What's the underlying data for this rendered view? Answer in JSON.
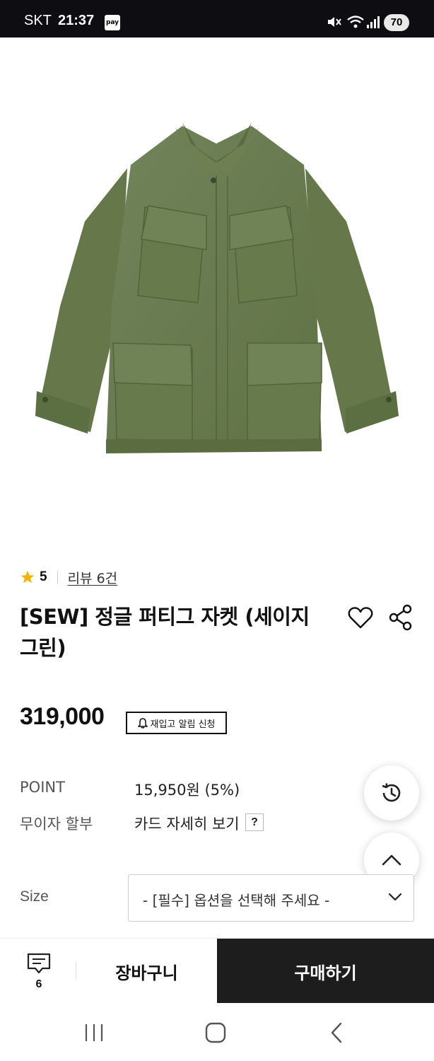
{
  "status_bar": {
    "carrier": "SKT",
    "time": "21:37",
    "pay_badge": "pay",
    "battery": "70",
    "icons": [
      "mute-icon",
      "wifi-icon",
      "signal-icon"
    ]
  },
  "product": {
    "image_alt": "product-image",
    "rating": {
      "score": "5",
      "review_link": "리뷰 6건",
      "star_color": "#f5b301"
    },
    "title": "[SEW] 정글 퍼티그 자켓 (세이지 그린)",
    "price": "319,000",
    "restock_label": "재입고 알림 신청",
    "info": [
      {
        "label": "POINT",
        "value": "15,950원 (5%)"
      },
      {
        "label": "무이자 할부",
        "value": "카드 자세히 보기",
        "help": "?"
      }
    ],
    "size": {
      "label": "Size",
      "placeholder": "- [필수] 옵션을 선택해 주세요 -"
    }
  },
  "bottom_bar": {
    "comment_count": "6",
    "cart_label": "장바구니",
    "buy_label": "구매하기",
    "buy_color": "#1d1d1d"
  },
  "colors": {
    "jacket": "#6a7c4c",
    "status_bar": "#0d0d12"
  }
}
